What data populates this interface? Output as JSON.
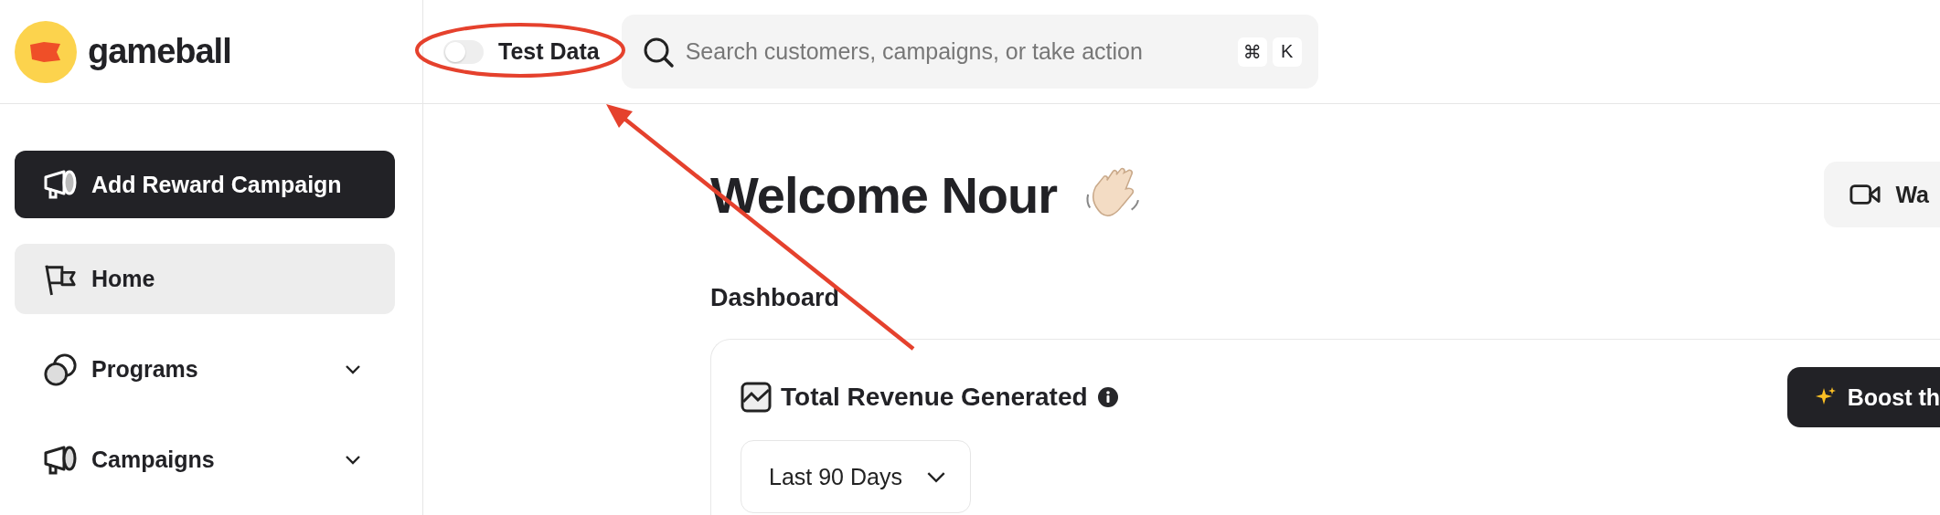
{
  "brand": {
    "name": "gameball"
  },
  "test_data_toggle": {
    "label": "Test Data",
    "on": false
  },
  "search": {
    "placeholder": "Search customers, campaigns, or take action",
    "shortcut": [
      "⌘",
      "K"
    ]
  },
  "sidebar": {
    "primary_action": "Add Reward Campaign",
    "items": [
      {
        "label": "Home",
        "kind": "link",
        "selected": true
      },
      {
        "label": "Programs",
        "kind": "group",
        "selected": false
      },
      {
        "label": "Campaigns",
        "kind": "group",
        "selected": false
      }
    ]
  },
  "main": {
    "greeting": "Welcome Nour",
    "watch_button": "Wa",
    "section_title": "Dashboard",
    "card": {
      "title": "Total Revenue Generated",
      "boost_button": "Boost th",
      "period": "Last 90 Days"
    }
  }
}
